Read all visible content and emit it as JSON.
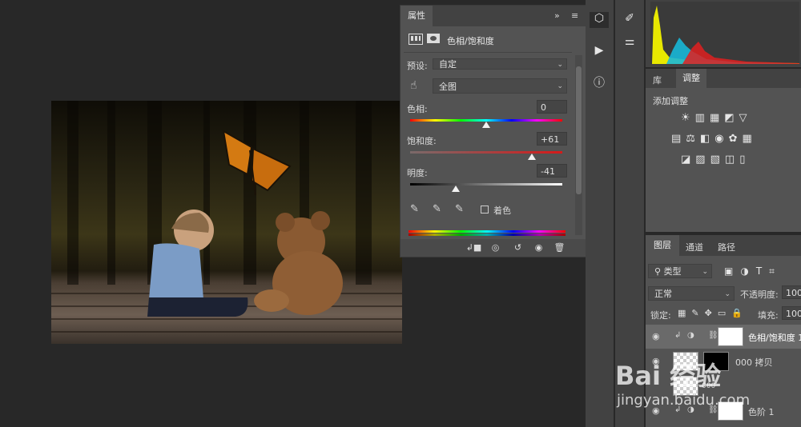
{
  "properties": {
    "tab_label": "属性",
    "panel_title": "色相/饱和度",
    "preset_label": "预设:",
    "preset_value": "自定",
    "channel_value": "全图",
    "hue_label": "色相:",
    "hue_value": "0",
    "saturation_label": "饱和度:",
    "saturation_value": "+61",
    "lightness_label": "明度:",
    "lightness_value": "-41",
    "colorize_label": "着色",
    "collapse_glyph": "»",
    "menu_glyph": "≡",
    "hue_fraction": 0.5,
    "saturation_fraction": 0.8,
    "lightness_fraction": 0.3
  },
  "adjust_panel": {
    "tab_library": "库",
    "tab_adjust": "调整",
    "add_adjust_label": "添加调整"
  },
  "layers_panel": {
    "tab_layers": "图层",
    "tab_channels": "通道",
    "tab_paths": "路径",
    "kind_filter": "类型",
    "blend_mode": "正常",
    "opacity_label": "不透明度:",
    "opacity_value": "100",
    "lock_label": "锁定:",
    "fill_label": "填充:",
    "fill_value": "100",
    "layers": [
      {
        "name": "色相/饱和度 1"
      },
      {
        "name": "000 拷贝"
      },
      {
        "name": "000"
      },
      {
        "name": "色阶 1"
      }
    ]
  },
  "watermark": {
    "brand": "Bai 经验",
    "url": "jingyan.baidu.com"
  }
}
